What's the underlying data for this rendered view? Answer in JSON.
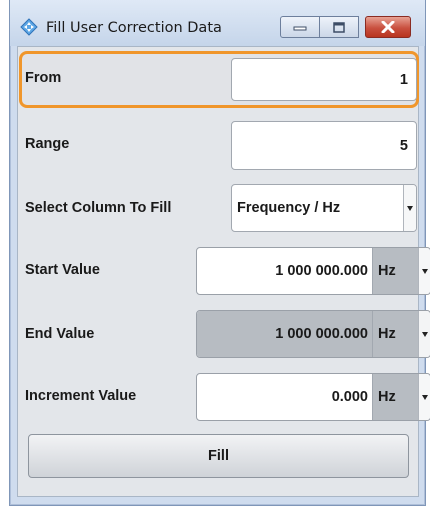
{
  "window": {
    "title": "Fill User Correction Data",
    "icons": {
      "app": "diamond-arrows-icon",
      "minimize": "minimize-icon",
      "maximize": "maximize-icon",
      "close": "close-icon"
    }
  },
  "form": {
    "from": {
      "label": "From",
      "value": "1"
    },
    "range": {
      "label": "Range",
      "value": "5"
    },
    "select_column": {
      "label": "Select Column To Fill",
      "value": "Frequency / Hz"
    },
    "start_value": {
      "label": "Start Value",
      "value": "1 000 000.000",
      "unit": "Hz"
    },
    "end_value": {
      "label": "End Value",
      "value": "1 000 000.000",
      "unit": "Hz"
    },
    "increment_value": {
      "label": "Increment Value",
      "value": "0.000",
      "unit": "Hz"
    },
    "fill_button": {
      "label": "Fill"
    }
  },
  "colors": {
    "focus_highlight": "#f0962b",
    "disabled_field": "#b7bcc2",
    "close_button": "#c9503f"
  }
}
